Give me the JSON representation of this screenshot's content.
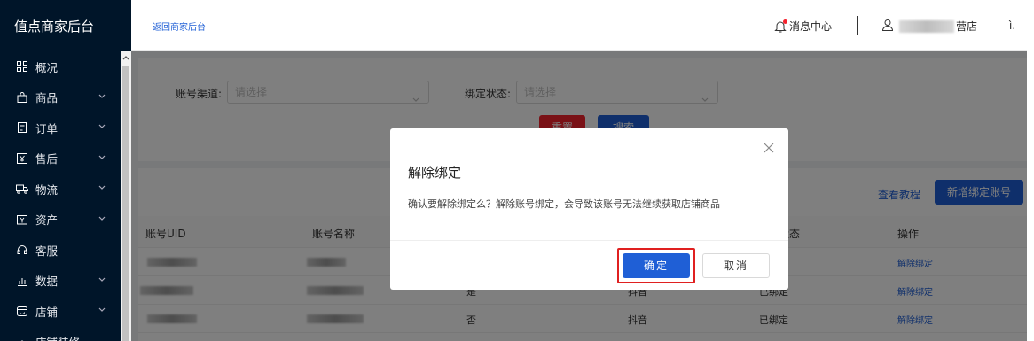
{
  "sidebar": {
    "brand": "值点商家后台",
    "items": [
      {
        "label": "概况",
        "icon": "grid-icon",
        "expandable": false
      },
      {
        "label": "商品",
        "icon": "bag-icon",
        "expandable": true
      },
      {
        "label": "订单",
        "icon": "document-icon",
        "expandable": true
      },
      {
        "label": "售后",
        "icon": "yen-box-icon",
        "expandable": true
      },
      {
        "label": "物流",
        "icon": "truck-icon",
        "expandable": true
      },
      {
        "label": "资产",
        "icon": "wallet-icon",
        "expandable": true
      },
      {
        "label": "客服",
        "icon": "headset-icon",
        "expandable": false
      },
      {
        "label": "数据",
        "icon": "bar-chart-icon",
        "expandable": true
      },
      {
        "label": "店铺",
        "icon": "shop-icon",
        "expandable": true
      },
      {
        "label": "店铺装修",
        "icon": "paint-icon",
        "expandable": false
      }
    ]
  },
  "header": {
    "back_link": "返回商家后台",
    "messages": "消息中心",
    "user_prefix": "",
    "user_suffix": "营店",
    "tail": "ì."
  },
  "filters": {
    "channel_label": "账号渠道:",
    "channel_placeholder": "请选择",
    "status_label": "绑定状态:",
    "status_placeholder": "请选择",
    "reset": "重置",
    "search": "搜索"
  },
  "list": {
    "tutorial": "查看教程",
    "add_button": "新增绑定账号",
    "columns": [
      "账号UID",
      "账号名称",
      "",
      "",
      "状态",
      "操作"
    ],
    "rows": [
      {
        "col3": "",
        "col4": "",
        "status": "",
        "action": "解除绑定"
      },
      {
        "col3": "是",
        "col4": "抖音",
        "status": "已绑定",
        "action": "解除绑定"
      },
      {
        "col3": "否",
        "col4": "抖音",
        "status": "已绑定",
        "action": "解除绑定"
      }
    ]
  },
  "dialog": {
    "title": "解除绑定",
    "message": "确认要解除绑定么？解除账号绑定，会导致该账号无法继续获取店铺商品",
    "confirm": "确定",
    "cancel": "取消"
  },
  "colors": {
    "sidebar_bg": "#001529",
    "primary": "#1f5fd6",
    "danger": "#f5222d",
    "highlight_box": "#e02020"
  }
}
